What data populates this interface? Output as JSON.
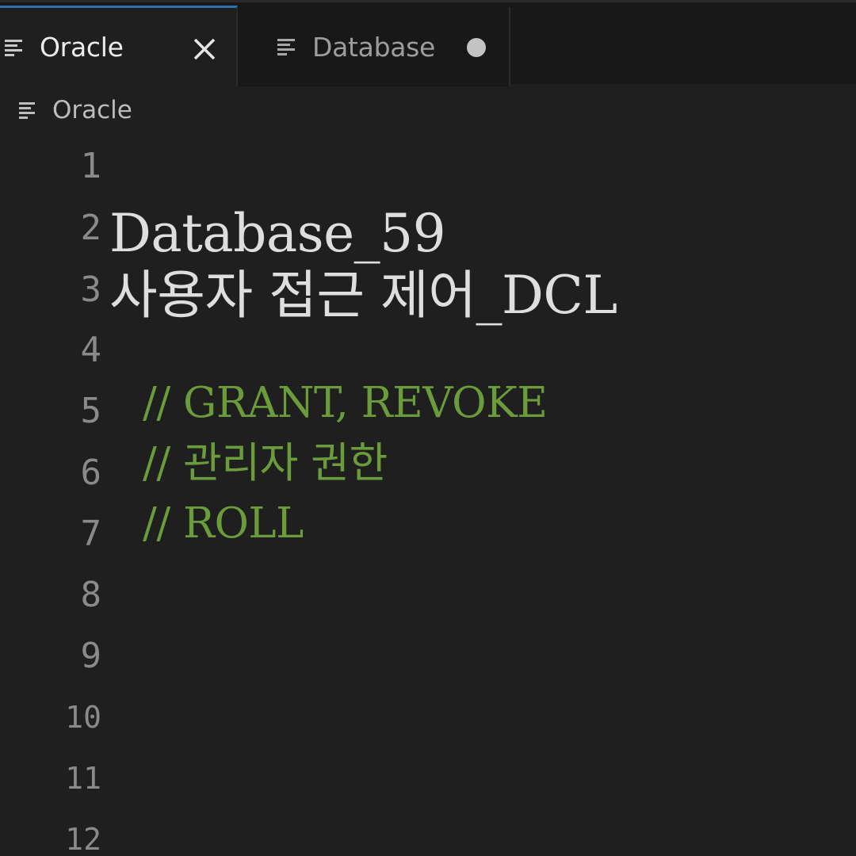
{
  "tabs": [
    {
      "label": "Oracle",
      "state": "active",
      "action_icon": "close-icon"
    },
    {
      "label": "Database",
      "state": "inactive",
      "action_icon": "unsaved-dot-icon"
    }
  ],
  "breadcrumb": {
    "label": "Oracle",
    "icon": "text-file-icon"
  },
  "editor": {
    "line_numbers": [
      "1",
      "2",
      "3",
      "4",
      "5",
      "6",
      "7",
      "8",
      "9",
      "10",
      "11",
      "12"
    ],
    "title_line_1": "Database_59",
    "title_line_2": "사용자 접근 제어_DCL",
    "comments": [
      "// GRANT, REVOKE",
      "// 관리자 권한",
      "// ROLL"
    ]
  },
  "colors": {
    "background": "#1f1f1f",
    "tab_bar": "#181818",
    "comment": "#6a9c3c",
    "line_number": "#8a8a8a",
    "text": "#dedede"
  }
}
